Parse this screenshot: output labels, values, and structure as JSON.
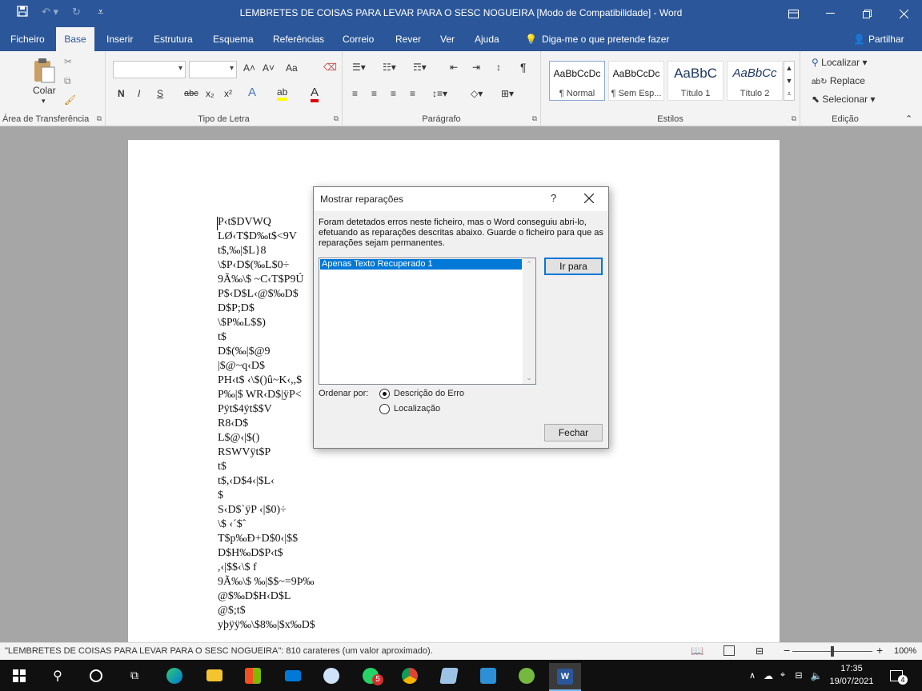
{
  "window": {
    "title": "LEMBRETES DE COISAS PARA LEVAR PARA O SESC NOGUEIRA [Modo de Compatibilidade]  -  Word"
  },
  "tabs": [
    {
      "label": "Ficheiro"
    },
    {
      "label": "Base"
    },
    {
      "label": "Inserir"
    },
    {
      "label": "Estrutura"
    },
    {
      "label": "Esquema"
    },
    {
      "label": "Referências"
    },
    {
      "label": "Correio"
    },
    {
      "label": "Rever"
    },
    {
      "label": "Ver"
    },
    {
      "label": "Ajuda"
    }
  ],
  "tell_me": "Diga-me o que pretende fazer",
  "share": "Partilhar",
  "ribbon": {
    "clipboard": {
      "paste": "Colar",
      "label": "Área de Transferência"
    },
    "font": {
      "label": "Tipo de Letra",
      "bold": "N",
      "italic": "I",
      "underline": "S",
      "strike": "abc",
      "sub": "x₂",
      "sup": "x²",
      "grow": "A˄",
      "shrink": "A˅",
      "case": "Aa"
    },
    "paragraph": {
      "label": "Parágrafo"
    },
    "styles": {
      "label": "Estilos",
      "items": [
        {
          "preview": "AaBbCcDc",
          "name": "¶ Normal"
        },
        {
          "preview": "AaBbCcDc",
          "name": "¶ Sem Esp..."
        },
        {
          "preview": "AaBbC",
          "name": "Título 1"
        },
        {
          "preview": "AaBbCc",
          "name": "Título 2"
        }
      ]
    },
    "editing": {
      "label": "Edição",
      "find": "Localizar",
      "replace": "Replace",
      "select": "Selecionar"
    }
  },
  "document": {
    "lines": [
      "P‹t$DVWQ",
      "LØ‹T$D‰t$<9V",
      "t$,‰|$L}8",
      "\\$P‹D$(‰L$0÷",
      "9Ã‰\\$ ~C‹T$P9Ú",
      "P$‹D$L‹@$‰D$",
      "D$P;D$",
      "\\$P‰L$$)",
      "t$",
      "D$(‰|$@9",
      "|$@~q‹D$",
      "PH‹t$ ‹\\$()û~K‹,,$",
      "P‰|$ WR‹D$|ÿP<",
      "Pÿt$4ÿt$$V",
      "R8‹D$",
      "L$@‹|$()",
      "RSWVÿt$P",
      "t$",
      "t$,‹D$4‹|$L‹",
      "$",
      "S‹D$`ÿP ‹|$0)÷",
      "\\$ ‹´$ˆ",
      "T$p‰Ð+D$0‹|$$",
      "D$H‰D$P‹t$",
      ",‹|$$‹\\$ f",
      "9Ã‰\\$ ‰|$$~=9Þ‰",
      "@$‰D$H‹D$L",
      "@$;t$",
      "yþÿÿ‰\\$8‰|$x‰D$"
    ]
  },
  "dialog": {
    "title": "Mostrar reparações",
    "help": "?",
    "message": "Foram detetados erros neste ficheiro, mas o Word conseguiu abri-lo, efetuando as reparações descritas abaixo. Guarde o ficheiro para que as reparações sejam permanentes.",
    "list_items": [
      "Apenas Texto Recuperado 1"
    ],
    "goto_button": "Ir para",
    "sort_label": "Ordenar por:",
    "sort_options": [
      {
        "label": "Descrição do Erro",
        "selected": true
      },
      {
        "label": "Localização",
        "selected": false
      }
    ],
    "close_button": "Fechar"
  },
  "status": {
    "text": "\"LEMBRETES DE COISAS PARA LEVAR PARA O SESC NOGUEIRA\": 810 carateres (um valor aproximado).",
    "zoom": "100%",
    "minus": "−",
    "plus": "+",
    "zoom_fraction": 0.5
  },
  "taskbar": {
    "time": "17:35",
    "date": "19/07/2021",
    "whatsapp_badge": "5",
    "notifications": "4"
  },
  "colors": {
    "accent": "#2b579a",
    "selection": "#0078d7"
  }
}
